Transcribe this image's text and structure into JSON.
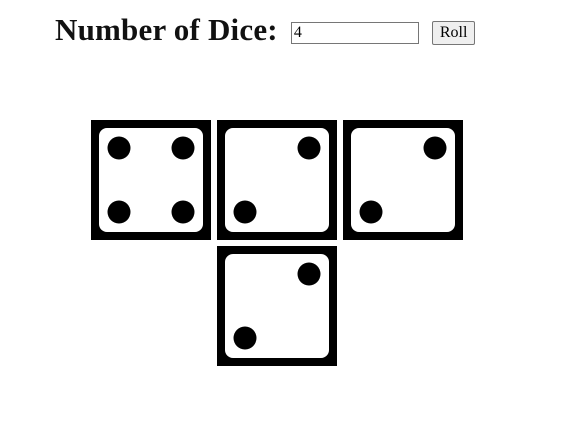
{
  "header": {
    "title": "Number of Dice:",
    "count_value": "4",
    "roll_label": "Roll"
  },
  "dice": [
    {
      "value": 4
    },
    {
      "value": 2
    },
    {
      "value": 2
    },
    {
      "value": 2
    }
  ],
  "colors": {
    "die_border": "#000000",
    "die_face": "#ffffff",
    "pip": "#000000"
  }
}
